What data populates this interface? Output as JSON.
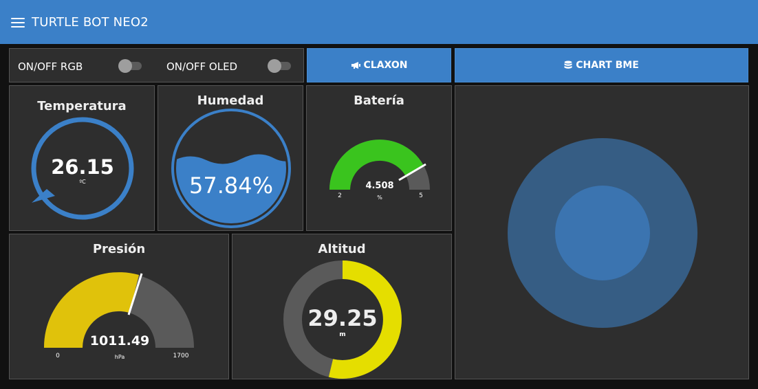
{
  "header": {
    "title": "TURTLE BOT NEO2",
    "bg_color": "#3b80c8"
  },
  "controls": {
    "rgb_toggle": {
      "label": "ON/OFF RGB",
      "checked": false
    },
    "oled_toggle": {
      "label": "ON/OFF OLED",
      "checked": false
    },
    "claxon_button": {
      "label": "CLAXON",
      "icon": "bullhorn-icon"
    },
    "chart_button": {
      "label": "CHART BME",
      "icon": "database-icon"
    }
  },
  "gauges": {
    "temperatura": {
      "title": "Temperatura",
      "value": "26.15",
      "unit": "ºC",
      "color": "#3b80c8"
    },
    "humedad": {
      "title": "Humedad",
      "value": "57.84%",
      "percent": 57.84,
      "color": "#3b80c8"
    },
    "bateria": {
      "title": "Batería",
      "value": "4.508",
      "unit": "%",
      "min": "2",
      "max": "5",
      "color": "#3ac41e"
    },
    "presion": {
      "title": "Presión",
      "value": "1011.49",
      "unit": "hPa",
      "min": "0",
      "max": "1700",
      "color": "#e0c20b"
    },
    "altitud": {
      "title": "Altitud",
      "value": "29.25",
      "unit": "m",
      "color": "#e5de00"
    }
  },
  "colors": {
    "card_bg": "#2e2e2e",
    "track": "#5a5a5a",
    "accent": "#3b80c8"
  }
}
